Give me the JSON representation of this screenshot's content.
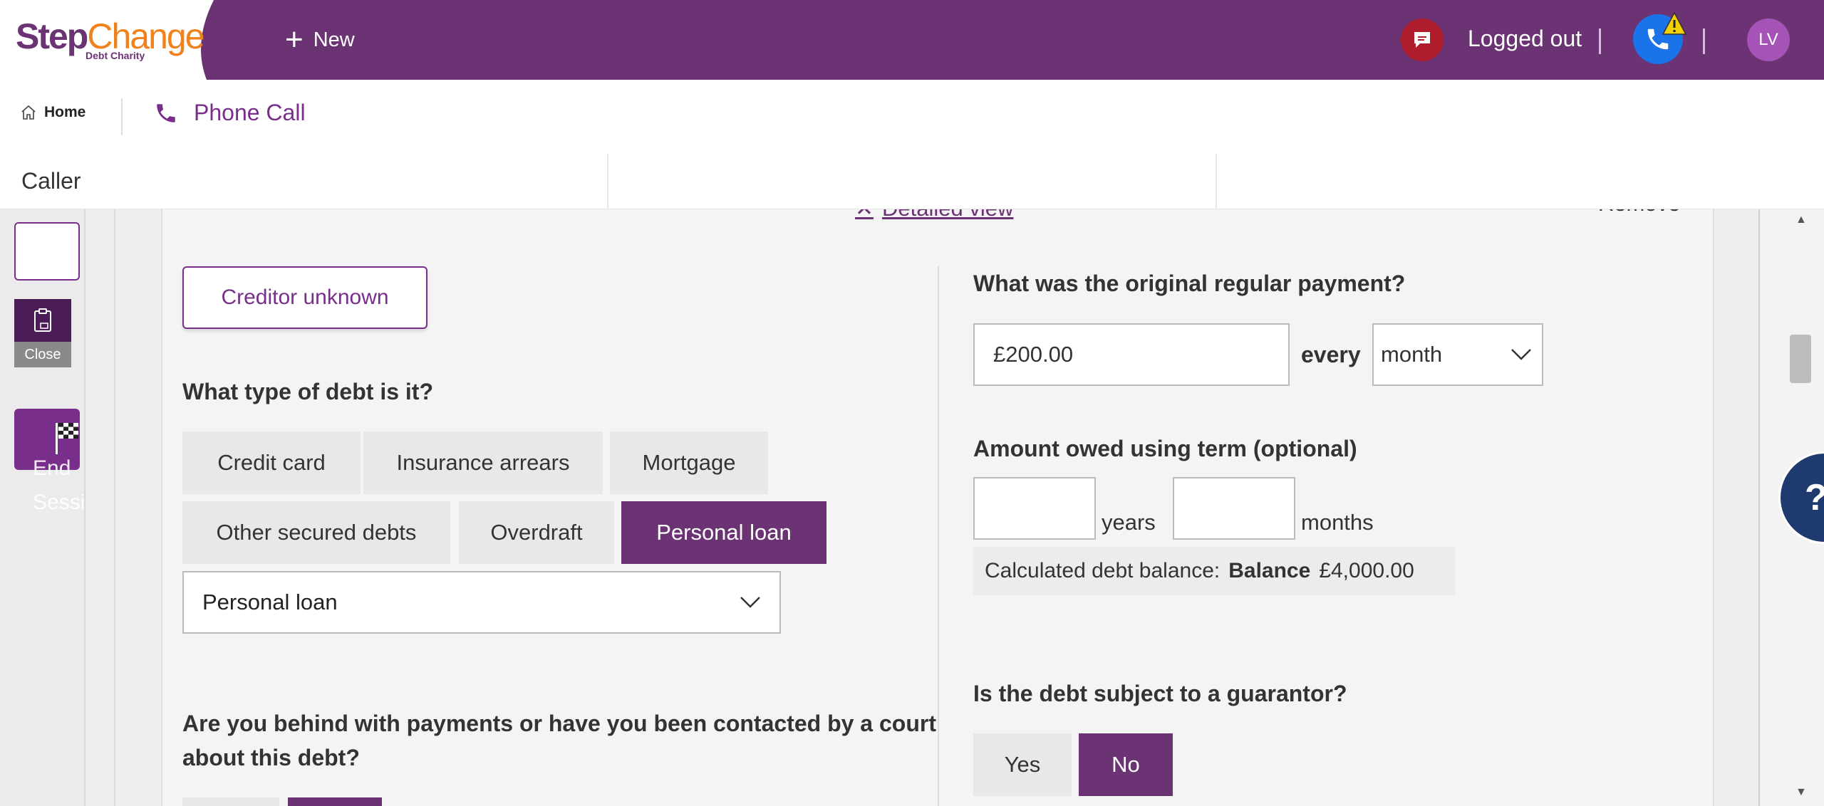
{
  "brand": {
    "logo_step": "Step",
    "logo_change": "Change",
    "logo_sub": "Debt Charity",
    "primary_color": "#6b3374",
    "accent_color": "#f0821e"
  },
  "topbar": {
    "new_label": "New",
    "status": "Logged out",
    "avatar_initials": "LV"
  },
  "tabs": {
    "home_label": "Home",
    "phone_call_label": "Phone Call"
  },
  "caller": {
    "label": "Caller"
  },
  "left_rail": {
    "close_label": "Close",
    "end_session_label_line1": "End",
    "end_session_label_line2": "Session"
  },
  "card": {
    "detailed_view_label": "Detailed view",
    "remove_label": "Remove",
    "creditor_unknown_label": "Creditor unknown",
    "debt_type_question": "What type of debt is it?",
    "debt_type_options": [
      {
        "label": "Credit card",
        "selected": false
      },
      {
        "label": "Insurance arrears",
        "selected": false
      },
      {
        "label": "Mortgage",
        "selected": false
      },
      {
        "label": "Other secured debts",
        "selected": false
      },
      {
        "label": "Overdraft",
        "selected": false
      },
      {
        "label": "Personal loan",
        "selected": true
      }
    ],
    "debt_type_dropdown_value": "Personal loan",
    "behind_question": "Are you behind with payments or have you been contacted by a court about this debt?",
    "original_payment_question": "What was the original regular payment?",
    "original_payment_value": "£200.00",
    "every_label": "every",
    "frequency_value": "month",
    "term_question": "Amount owed using term (optional)",
    "years_label": "years",
    "months_label": "months",
    "calc_label": "Calculated debt balance:",
    "calc_balance_label": "Balance",
    "calc_balance_value": "£4,000.00",
    "guarantor_question": "Is the debt subject to a guarantor?",
    "guarantor_yes": "Yes",
    "guarantor_no": "No"
  },
  "help": {
    "label": "?"
  }
}
